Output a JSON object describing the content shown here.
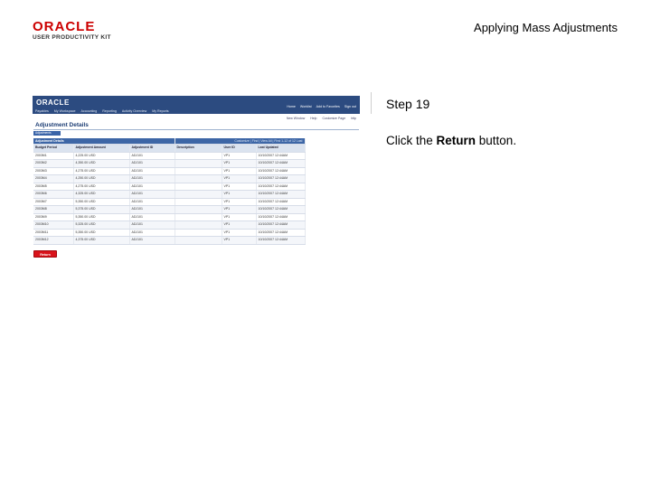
{
  "header": {
    "logo_main": "ORACLE",
    "logo_sub": "USER PRODUCTIVITY KIT",
    "document_title": "Applying Mass Adjustments"
  },
  "step": {
    "label": "Step 19",
    "instruction_prefix": "Click the ",
    "instruction_emphasis": "Return",
    "instruction_suffix": " button."
  },
  "screenshot": {
    "brand": "ORACLE",
    "header_links": [
      "Home",
      "Worklist",
      "Add to Favorites",
      "Sign out"
    ],
    "nav": [
      "Payables",
      "My Workspace",
      "Accounting",
      "Reporting",
      "Activity Overview",
      "My Reports"
    ],
    "tools": [
      "New Window",
      "Help",
      "Customize Page",
      "http"
    ],
    "page_title": "Adjustment Details",
    "section_tab": "Adjustments",
    "grid_title": "Adjustment Details",
    "grid_nav": "Customize | Find | View All | First 1-12 of 12 Last",
    "columns": [
      "Budget Period",
      "Adjustment Amount",
      "Adjustment ID",
      "Description",
      "User ID",
      "Last Updated"
    ],
    "rows": [
      [
        "2003M1",
        "4,225.00 USD",
        "ADJ101",
        "",
        "VP1",
        "10/10/2007 12:44AM"
      ],
      [
        "2003M2",
        "4,350.00 USD",
        "ADJ101",
        "",
        "VP1",
        "10/10/2007 12:44AM"
      ],
      [
        "2003M3",
        "4,275.00 USD",
        "ADJ101",
        "",
        "VP1",
        "10/10/2007 12:44AM"
      ],
      [
        "2003M4",
        "4,250.00 USD",
        "ADJ101",
        "",
        "VP1",
        "10/10/2007 12:44AM"
      ],
      [
        "2003M5",
        "4,275.00 USD",
        "ADJ101",
        "",
        "VP1",
        "10/10/2007 12:44AM"
      ],
      [
        "2003M6",
        "4,325.00 USD",
        "ADJ101",
        "",
        "VP1",
        "10/10/2007 12:44AM"
      ],
      [
        "2003M7",
        "5,350.00 USD",
        "ADJ101",
        "",
        "VP1",
        "10/10/2007 12:44AM"
      ],
      [
        "2003M8",
        "5,375.00 USD",
        "ADJ101",
        "",
        "VP1",
        "10/10/2007 12:44AM"
      ],
      [
        "2003M9",
        "5,350.00 USD",
        "ADJ101",
        "",
        "VP1",
        "10/10/2007 12:44AM"
      ],
      [
        "2003M10",
        "5,325.00 USD",
        "ADJ101",
        "",
        "VP1",
        "10/10/2007 12:44AM"
      ],
      [
        "2003M11",
        "5,350.00 USD",
        "ADJ101",
        "",
        "VP1",
        "10/10/2007 12:44AM"
      ],
      [
        "2003M12",
        "4,375.00 USD",
        "ADJ101",
        "",
        "VP1",
        "10/10/2007 12:44AM"
      ]
    ],
    "return_button": "Return"
  }
}
